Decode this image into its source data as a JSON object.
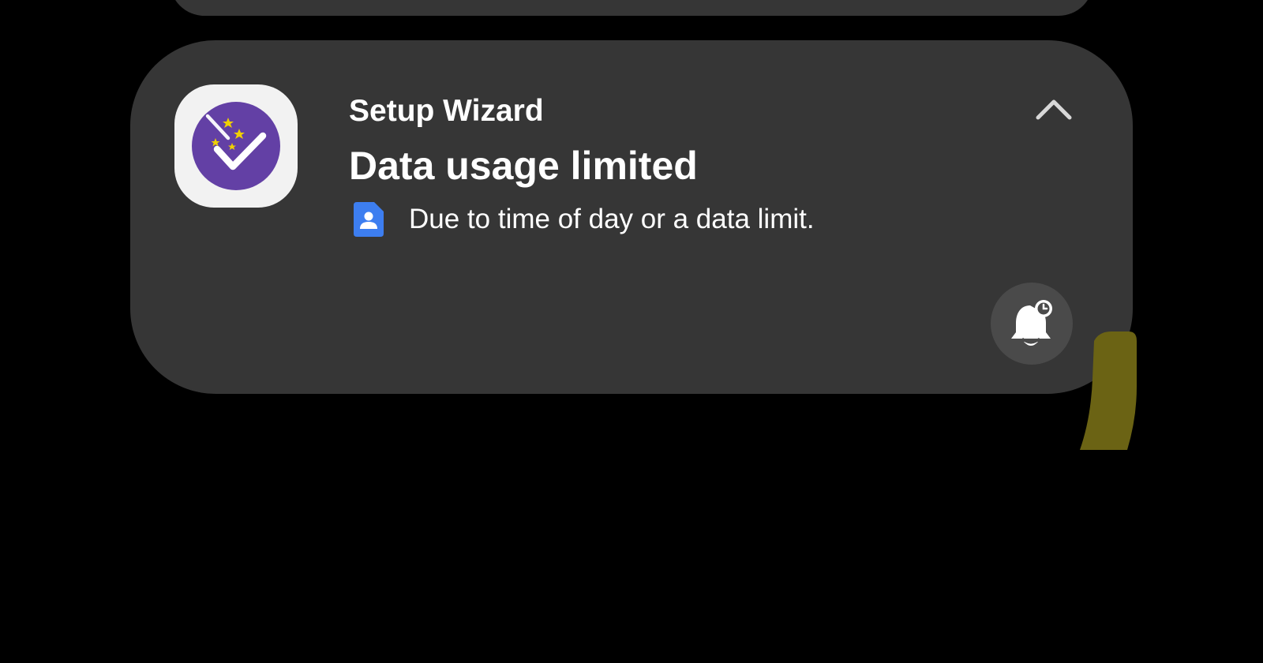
{
  "notification": {
    "app_name": "Setup Wizard",
    "title": "Data usage limited",
    "body": "Due to time of day or a data limit."
  },
  "icons": {
    "app_icon": "setup-wizard-check-icon",
    "sim_icon": "sim-card-contact-icon",
    "collapse_icon": "chevron-up-icon",
    "snooze_icon": "bell-snooze-icon"
  },
  "colors": {
    "background": "#000000",
    "card": "#363636",
    "app_icon_purple": "#6340a5",
    "sim_icon_blue": "#3d7ef0",
    "edge_stroke": "#6b6314"
  }
}
